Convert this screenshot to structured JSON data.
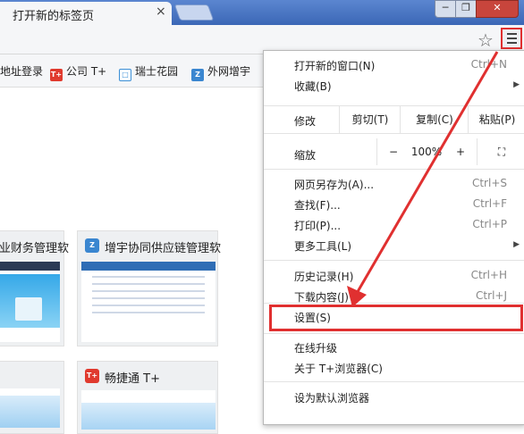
{
  "tab": {
    "title": "打开新的标签页",
    "close": "×"
  },
  "window": {
    "min": "─",
    "max": "❐",
    "close": "✕"
  },
  "bookmarks": [
    {
      "label": "地址登录",
      "icon_color": ""
    },
    {
      "label": "公司 T+",
      "icon_text": "T+",
      "icon_color": "#e03a2e"
    },
    {
      "label": "瑞士花园",
      "icon_text": "□",
      "icon_color": "#3b8fd6"
    },
    {
      "label": "外网增宇",
      "icon_text": "Z",
      "icon_color": "#3a86d0"
    }
  ],
  "tiles": [
    {
      "title": "业财务管理软"
    },
    {
      "title": "增宇协同供应链管理软",
      "icon_text": "Z",
      "icon_color": "#3a86d0"
    },
    {
      "title": "畅捷通 T+",
      "icon_text": "T+",
      "icon_color": "#e03a2e"
    }
  ],
  "menu": {
    "new_window": "打开新的窗口(N)",
    "new_window_sc": "Ctrl+N",
    "favorites": "收藏(B)",
    "edit": "修改",
    "cut": "剪切(T)",
    "copy": "复制(C)",
    "paste": "粘贴(P)",
    "zoom": "缩放",
    "zoom_minus": "−",
    "zoom_value": "100%",
    "zoom_plus": "+",
    "save_as": "网页另存为(A)...",
    "save_as_sc": "Ctrl+S",
    "find": "查找(F)...",
    "find_sc": "Ctrl+F",
    "print": "打印(P)...",
    "print_sc": "Ctrl+P",
    "more_tools": "更多工具(L)",
    "history": "历史记录(H)",
    "history_sc": "Ctrl+H",
    "downloads": "下载内容(J)",
    "downloads_sc": "Ctrl+J",
    "settings": "设置(S)",
    "upgrade": "在线升级",
    "about": "关于 T+浏览器(C)",
    "default": "设为默认浏览器"
  },
  "colors": {
    "highlight": "#e03030",
    "accent": "#3b67b6"
  }
}
